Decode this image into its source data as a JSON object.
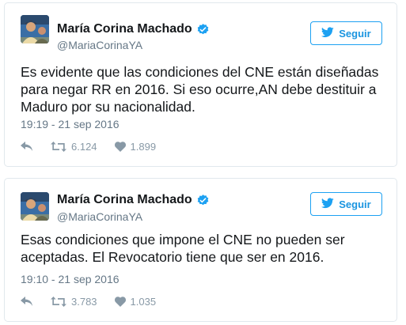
{
  "tweets": [
    {
      "author_name": "María Corina Machado",
      "handle": "@MariaCorinaYA",
      "follow_label": "Seguir",
      "text": "Es evidente que las condiciones del CNE están diseñadas para negar RR en 2016. Si eso ocurre,AN debe destituir a Maduro por su nacionalidad.",
      "timestamp": "19:19 - 21 sep 2016",
      "retweets": "6.124",
      "likes": "1.899"
    },
    {
      "author_name": "María Corina Machado",
      "handle": "@MariaCorinaYA",
      "follow_label": "Seguir",
      "text": "Esas condiciones que impone el CNE no pueden ser aceptadas. El Revocatorio tiene que ser en 2016.",
      "timestamp": "19:10 - 21 sep 2016",
      "retweets": "3.783",
      "likes": "1.035"
    }
  ],
  "colors": {
    "twitter_blue": "#1da1f2",
    "secondary_text": "#657786",
    "action_gray": "#8899a6"
  },
  "icons": [
    "verified-badge-icon",
    "twitter-bird-icon",
    "reply-icon",
    "retweet-icon",
    "heart-icon"
  ]
}
